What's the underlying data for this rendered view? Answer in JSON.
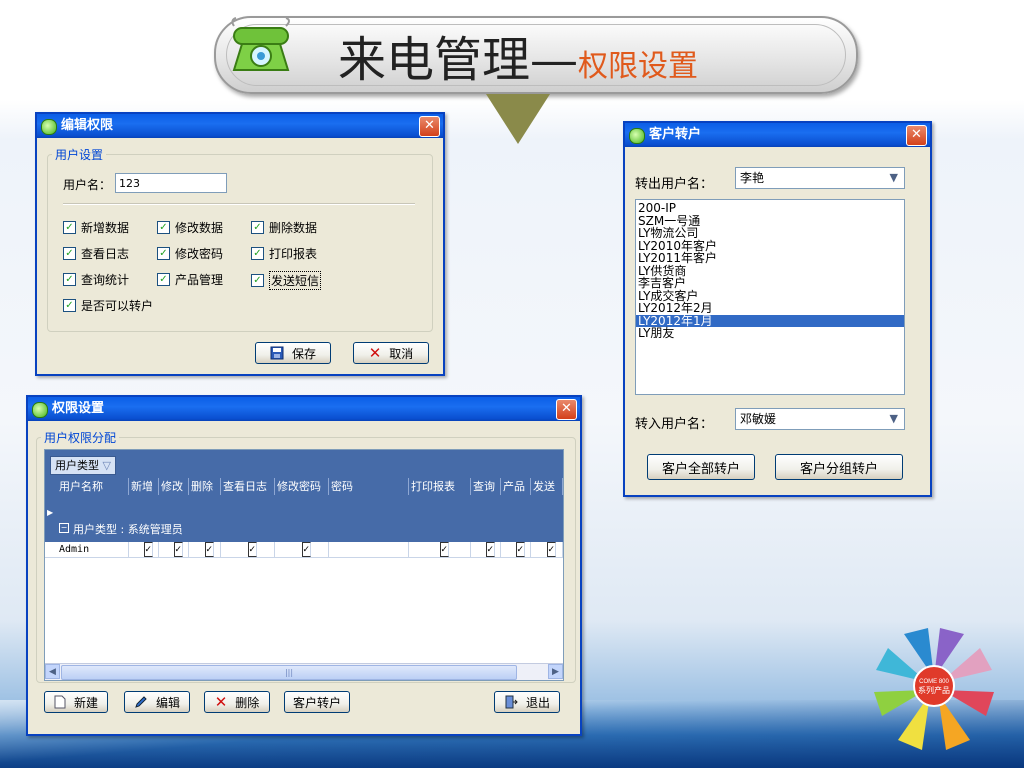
{
  "slide": {
    "title_main": "来电管理—",
    "title_sub": "权限设置"
  },
  "edit_perm_window": {
    "title": "编辑权限",
    "close": "✕",
    "group_label": "用户设置",
    "username_label": "用户名：",
    "username_value": "123",
    "checks": [
      {
        "label": "新增数据",
        "checked": true
      },
      {
        "label": "修改数据",
        "checked": true
      },
      {
        "label": "删除数据",
        "checked": true
      },
      {
        "label": "查看日志",
        "checked": true
      },
      {
        "label": "修改密码",
        "checked": true
      },
      {
        "label": "打印报表",
        "checked": true
      },
      {
        "label": "查询统计",
        "checked": true
      },
      {
        "label": "产品管理",
        "checked": true
      },
      {
        "label": "发送短信",
        "checked": true
      },
      {
        "label": "是否可以转户",
        "checked": true
      }
    ],
    "save_label": "保存",
    "cancel_label": "取消"
  },
  "customer_transfer_window": {
    "title": "客户转户",
    "close": "✕",
    "from_label": "转出用户名：",
    "from_value": "李艳",
    "list_items": [
      "200-IP",
      "SZM一号通",
      "LY物流公司",
      "LY2010年客户",
      "LY2011年客户",
      "LY供货商",
      "李吉客户",
      "LY成交客户",
      "LY2012年2月",
      "LY2012年1月",
      "LY朋友"
    ],
    "selected_index": 9,
    "to_label": "转入用户名：",
    "to_value": "邓敏媛",
    "all_transfer_label": "客户全部转户",
    "group_transfer_label": "客户分组转户"
  },
  "perm_settings_window": {
    "title": "权限设置",
    "close": "✕",
    "group_label": "用户权限分配",
    "group_by_tag": "用户类型",
    "columns": [
      "用户名称",
      "新增",
      "修改",
      "删除",
      "查看日志",
      "修改密码",
      "密码",
      "打印报表",
      "查询",
      "产品",
      "发送"
    ],
    "group_row": "用户类型 : 系统管理员",
    "row": {
      "name": "Admin",
      "checks": [
        "✓",
        "✓",
        "✓",
        "✓",
        "✓",
        "",
        "✓",
        "✓",
        "✓",
        "✓"
      ]
    },
    "buttons": {
      "new": "新建",
      "edit": "编辑",
      "delete": "删除",
      "transfer": "客户转户",
      "exit": "退出"
    }
  },
  "logo": {
    "center_line1": "COME 800",
    "center_line2": "系列产品"
  },
  "colors": {
    "xp_blue": "#0842c0",
    "grid_blue": "#466ba8",
    "title_orange": "#e05a1c"
  }
}
